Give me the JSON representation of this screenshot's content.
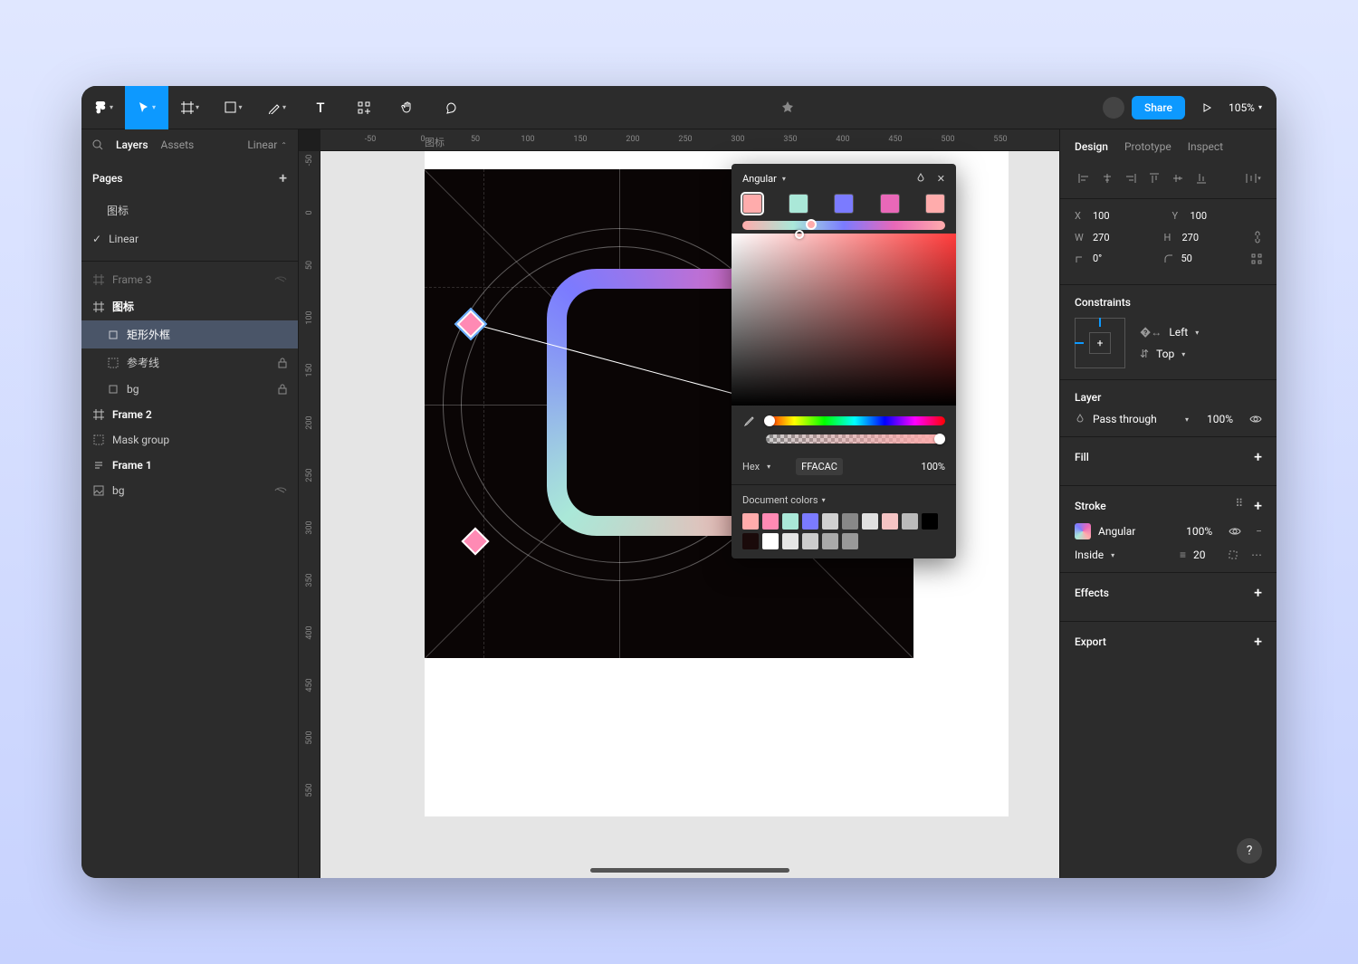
{
  "toolbar": {
    "share_label": "Share",
    "zoom": "105%"
  },
  "left_panel": {
    "tabs": {
      "layers": "Layers",
      "assets": "Assets"
    },
    "filter": "Linear",
    "pages_header": "Pages",
    "pages": [
      "图标",
      "Linear"
    ],
    "layers": [
      {
        "name": "Frame 3",
        "icon": "frame",
        "indent": 0
      },
      {
        "name": "图标",
        "icon": "frame",
        "indent": 0,
        "bold": true
      },
      {
        "name": "矩形外框",
        "icon": "rect",
        "indent": 1,
        "selected": true
      },
      {
        "name": "参考线",
        "icon": "group",
        "indent": 1,
        "locked": true
      },
      {
        "name": "bg",
        "icon": "rect",
        "indent": 1,
        "locked": true
      },
      {
        "name": "Frame 2",
        "icon": "frame",
        "indent": 0,
        "bold": true
      },
      {
        "name": "Mask group",
        "icon": "group",
        "indent": 0
      },
      {
        "name": "Frame 1",
        "icon": "text",
        "indent": 0,
        "bold": true
      },
      {
        "name": "bg",
        "icon": "image",
        "indent": 0,
        "hidden": true
      }
    ]
  },
  "canvas": {
    "hticks": [
      "-50",
      "0",
      "50",
      "100",
      "150",
      "200",
      "250",
      "300",
      "350",
      "400",
      "450",
      "500",
      "550"
    ],
    "vticks": [
      "-50",
      "0",
      "50",
      "100",
      "150",
      "200",
      "250",
      "300",
      "350",
      "400",
      "450",
      "500",
      "550"
    ],
    "frame_label": "图标"
  },
  "color_popup": {
    "type": "Angular",
    "stops": [
      "#ffacac",
      "#aae8d8",
      "#7b7bff",
      "#e968b8",
      "#ffacac"
    ],
    "hex_label": "Hex",
    "hex_value": "FFACAC",
    "opacity": "100%",
    "doc_colors_header": "Document colors",
    "doc_colors": [
      "#ffacac",
      "#ff8ab4",
      "#aae8d8",
      "#7b7bff",
      "#d0d0d0",
      "#888888",
      "#e0e0e0",
      "#f5c4c4",
      "#bbbbbb",
      "#000000",
      "#1a0a0a",
      "#ffffff",
      "#e5e5e5",
      "#cccccc",
      "#aaaaaa",
      "#999999"
    ]
  },
  "right_panel": {
    "tabs": {
      "design": "Design",
      "prototype": "Prototype",
      "inspect": "Inspect"
    },
    "x_label": "X",
    "x_val": "100",
    "y_label": "Y",
    "y_val": "100",
    "w_label": "W",
    "w_val": "270",
    "h_label": "H",
    "h_val": "270",
    "rot_val": "0°",
    "radius_val": "50",
    "constraints_header": "Constraints",
    "constraint_h": "Left",
    "constraint_v": "Top",
    "layer_header": "Layer",
    "blend_mode": "Pass through",
    "layer_opacity": "100%",
    "fill_header": "Fill",
    "stroke_header": "Stroke",
    "stroke_type": "Angular",
    "stroke_opacity": "100%",
    "stroke_position": "Inside",
    "stroke_width": "20",
    "effects_header": "Effects",
    "export_header": "Export"
  }
}
